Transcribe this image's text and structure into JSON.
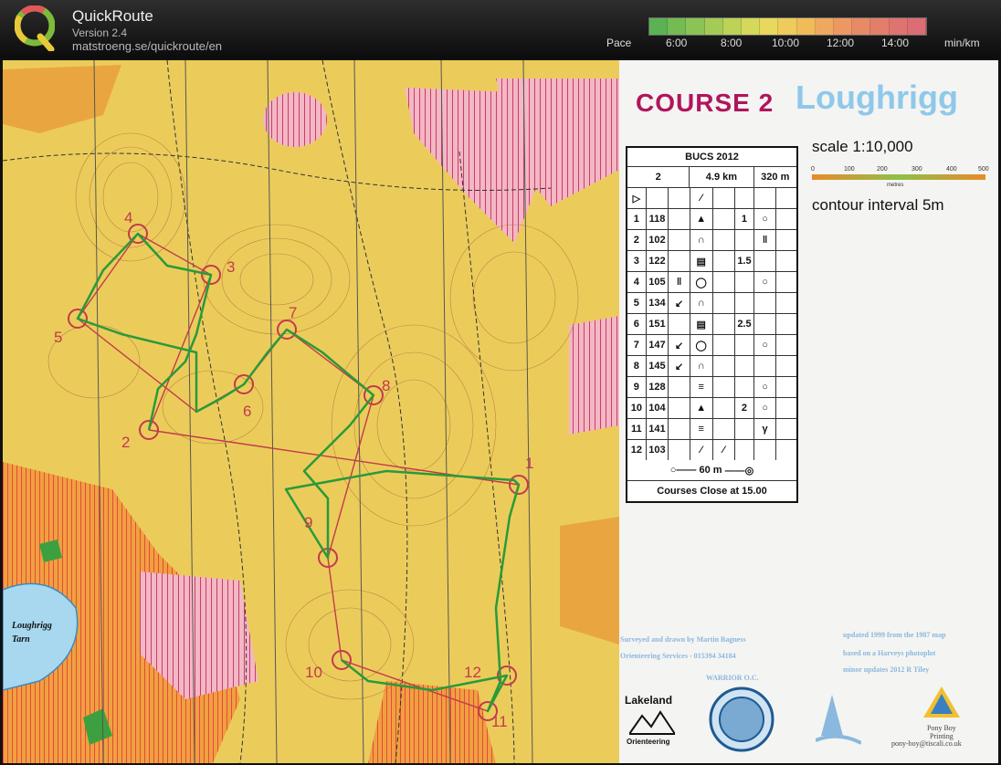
{
  "header": {
    "app_name": "QuickRoute",
    "version": "Version 2.4",
    "url": "matstroeng.se/quickroute/en",
    "pace_label": "Pace",
    "pace_ticks": [
      "6:00",
      "8:00",
      "10:00",
      "12:00",
      "14:00"
    ],
    "pace_unit": "min/km",
    "pace_colors": [
      "#4caf50",
      "#e8c93a",
      "#e0595a"
    ]
  },
  "map": {
    "course_title": "COURSE  2",
    "area_name": "Loughrigg",
    "scale": "scale 1:10,000",
    "scale_ticks": [
      "0",
      "100",
      "200",
      "300",
      "400",
      "500"
    ],
    "scale_unit": "metres",
    "contour_interval": "contour interval 5m",
    "tarn_line1": "Loughrigg",
    "tarn_line2": "Tarn",
    "control_numbers": [
      "1",
      "2",
      "3",
      "4",
      "5",
      "6",
      "7",
      "8",
      "9",
      "10",
      "11",
      "12"
    ],
    "credit_left_line1": "Surveyed and drawn by Martin Bagness",
    "credit_left_line2": "Orienteering Services - 015394 34184",
    "credit_right_line1": "updated 1999 from the 1987 map",
    "credit_right_line2": "based on a Harveys photoplot",
    "credit_right_line3": "minor updates 2012 R Tiley",
    "club": "WARRIOR O.C.",
    "lakeland": "Lakeland",
    "lakeland_sub": "Orienteering",
    "pony_line1": "Pony Boy",
    "pony_line2": "Printing",
    "pony_email": "pony-boy@tiscali.co.uk"
  },
  "description": {
    "event": "BUCS 2012",
    "course": "2",
    "length": "4.9 km",
    "climb": "320 m",
    "controls": [
      {
        "num": "1",
        "code": "118",
        "dim": "1"
      },
      {
        "num": "2",
        "code": "102",
        "dim": ""
      },
      {
        "num": "3",
        "code": "122",
        "dim": "1.5"
      },
      {
        "num": "4",
        "code": "105",
        "dim": ""
      },
      {
        "num": "5",
        "code": "134",
        "dim": ""
      },
      {
        "num": "6",
        "code": "151",
        "dim": "2.5"
      },
      {
        "num": "7",
        "code": "147",
        "dim": ""
      },
      {
        "num": "8",
        "code": "145",
        "dim": ""
      },
      {
        "num": "9",
        "code": "128",
        "dim": ""
      },
      {
        "num": "10",
        "code": "104",
        "dim": "2"
      },
      {
        "num": "11",
        "code": "141",
        "dim": ""
      },
      {
        "num": "12",
        "code": "103",
        "dim": ""
      }
    ],
    "finish_distance": "60 m",
    "footer": "Courses Close at 15.00"
  }
}
